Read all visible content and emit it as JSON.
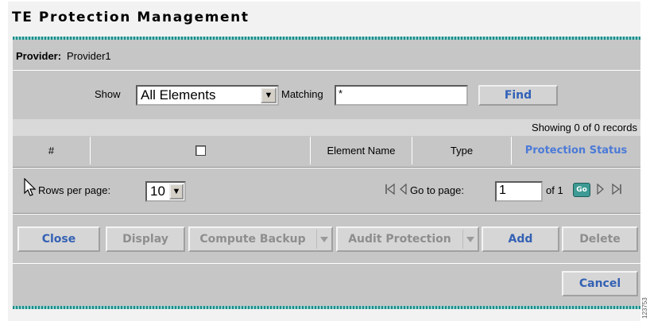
{
  "page": {
    "title": "TE Protection Management"
  },
  "provider": {
    "label": "Provider:",
    "value": "Provider1"
  },
  "filter": {
    "show_label": "Show",
    "show_value": "All Elements",
    "matching_label": "Matching",
    "matching_value": "*",
    "find_label": "Find"
  },
  "status": {
    "text": "Showing 0 of 0 records"
  },
  "table": {
    "columns": [
      "#",
      "",
      "Element Name",
      "Type",
      "Protection Status"
    ],
    "rows": []
  },
  "pager": {
    "rows_per_page_label": "Rows per page:",
    "rows_per_page_value": "10",
    "goto_label": "Go to page:",
    "goto_value": "1",
    "of_label": "of 1",
    "go_label": "Go"
  },
  "actions": {
    "close": "Close",
    "display": "Display",
    "compute_backup": "Compute Backup",
    "audit_protection": "Audit Protection",
    "add": "Add",
    "delete": "Delete",
    "cancel": "Cancel"
  },
  "colors": {
    "accent_blue": "#3461b4",
    "header_link_blue": "#4b7ad8",
    "rule_teal": "#1d8b88",
    "panel_gray": "#c6c6c6"
  },
  "figure_id": "123753"
}
